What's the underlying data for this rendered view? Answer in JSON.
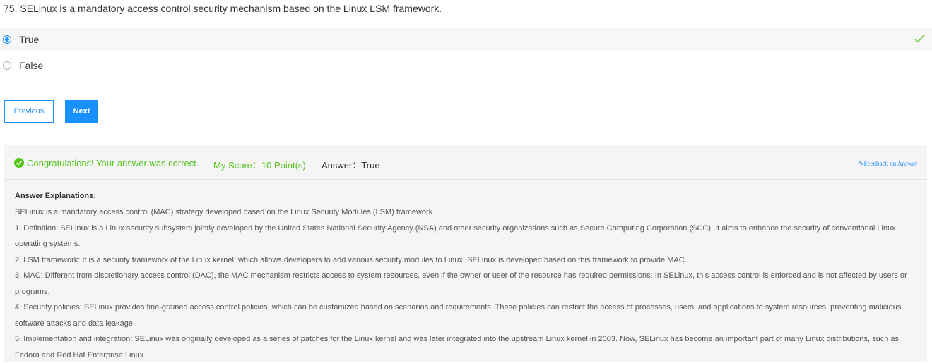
{
  "question": {
    "text": "75. SELinux is a mandatory access control security mechanism based on the Linux LSM framework."
  },
  "options": [
    {
      "label": "True",
      "selected": true
    },
    {
      "label": "False",
      "selected": false
    }
  ],
  "buttons": {
    "previous": "Previous",
    "next": "Next"
  },
  "result": {
    "congrats": "Congratulations! Your answer was correct.",
    "score": "My Score：10 Point(s)",
    "answer": "Answer：True",
    "feedback": "Feedback on Answer"
  },
  "explanation": {
    "title": "Answer Explanations:",
    "paragraphs": [
      "SELinux is a mandatory access control (MAC) strategy developed based on the Linux Security Modules (LSM) framework.",
      "1. Definition: SELinux is a Linux security subsystem jointly developed by the United States National Security Agency (NSA) and other security organizations such as Secure Computing Corporation (SCC). It aims to enhance the security of conventional Linux operating systems.",
      "2. LSM framework: It is a security framework of the Linux kernel, which allows developers to add various security modules to Linux. SELinux is developed based on this framework to provide MAC.",
      "3. MAC: Different from discretionary access control (DAC), the MAC mechanism restricts access to system resources, even if the owner or user of the resource has required permissions. In SELinux, this access control is enforced and is not affected by users or programs.",
      "4. Security policies: SELinux provides fine-grained access control policies, which can be customized based on scenarios and requirements. These policies can restrict the access of processes, users, and applications to system resources, preventing malicious software attacks and data leakage.",
      "5. Implementation and integration: SELinux was originally developed as a series of patches for the Linux kernel and was later integrated into the upstream Linux kernel in 2003. Now, SELinux has become an important part of many Linux distributions, such as Fedora and Red Hat Enterprise Linux."
    ]
  },
  "colors": {
    "accent": "#1890ff",
    "success": "#52c41a",
    "panel_bg": "#f5f5f5"
  },
  "icons": {
    "correct": "check-icon",
    "congrats": "check-circle-icon",
    "feedback": "edit-icon"
  }
}
